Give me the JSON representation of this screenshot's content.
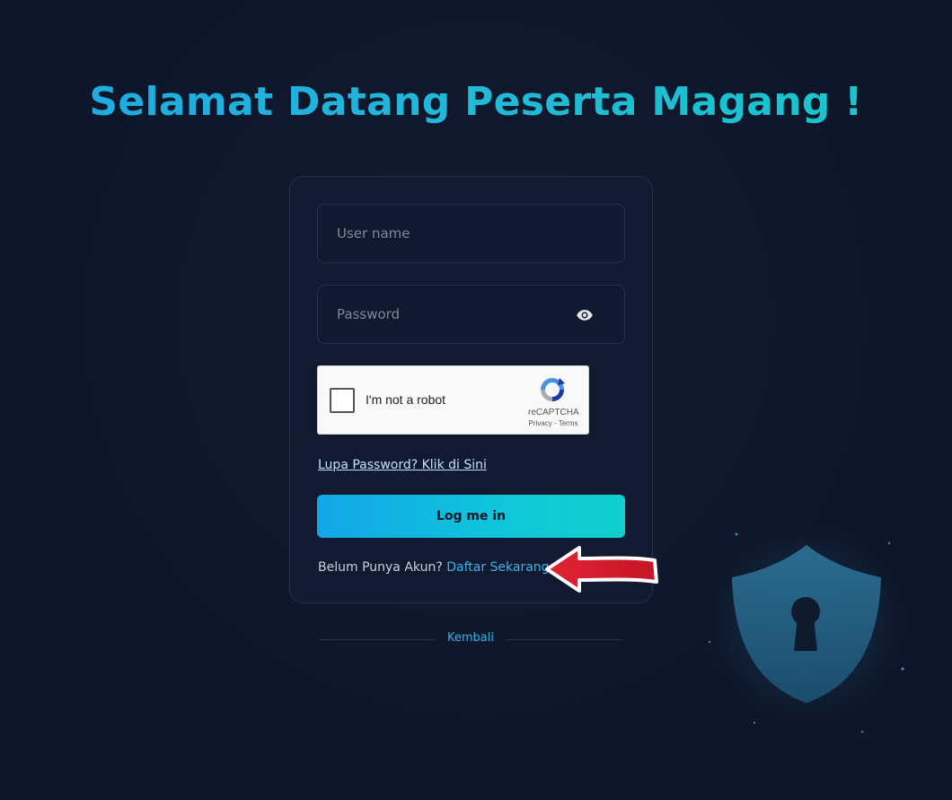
{
  "page": {
    "title": "Selamat Datang Peserta Magang !"
  },
  "form": {
    "username_placeholder": "User name",
    "password_placeholder": "Password",
    "captcha": {
      "label": "I'm not a robot",
      "brand": "reCAPTCHA",
      "links": "Privacy - Terms"
    },
    "forgot_link": "Lupa Password? Klik di Sini",
    "login_button": "Log me in",
    "signup_prompt": "Belum Punya Akun?",
    "signup_link": "Daftar Sekarang"
  },
  "footer": {
    "back_link": "Kembali"
  },
  "icons": {
    "eye": "eye-icon",
    "recaptcha": "recaptcha-logo-icon",
    "arrow": "arrow-left-icon",
    "shield": "shield-lock-icon"
  },
  "colors": {
    "background": "#0f172a",
    "accent": "#1ea8e4",
    "accent_end": "#10cfcd",
    "arrow": "#d81e2c"
  }
}
